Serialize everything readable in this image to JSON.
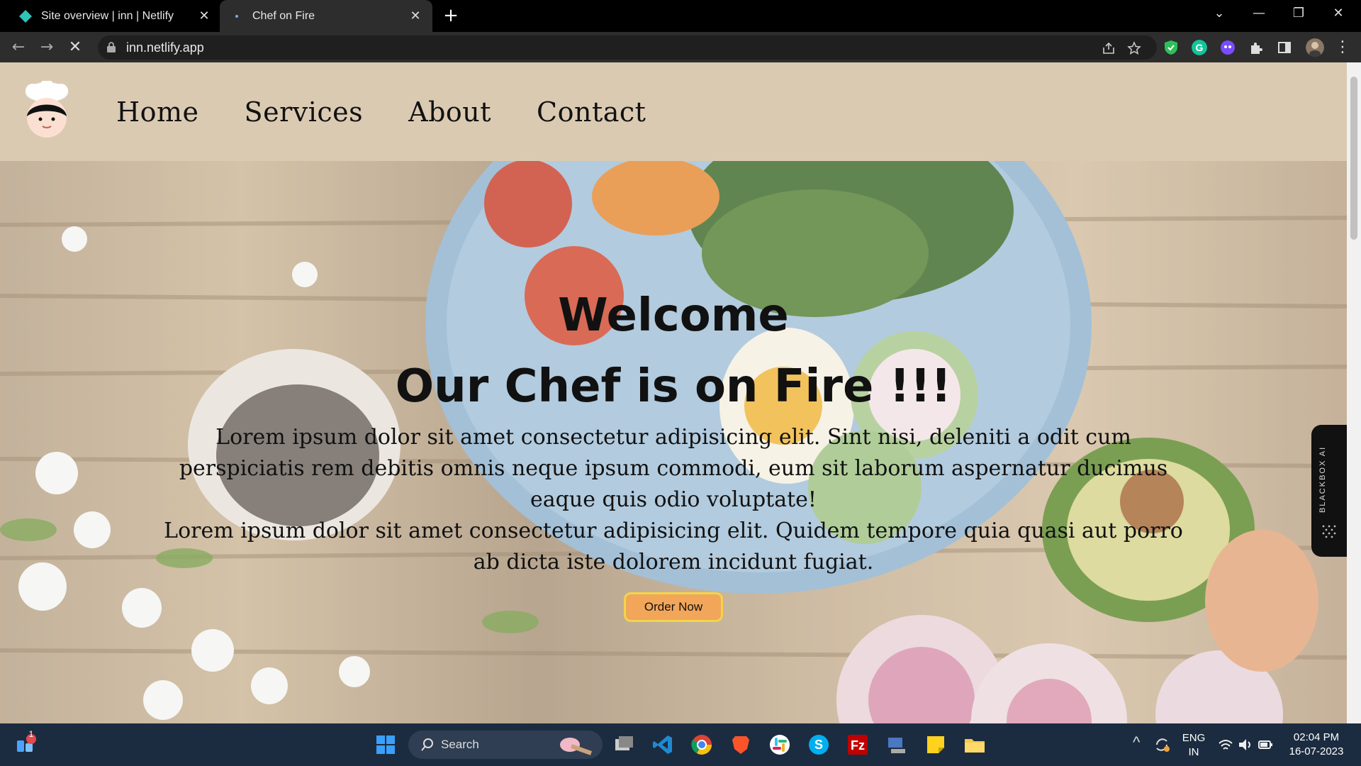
{
  "browser": {
    "tabs": [
      {
        "title": "Site overview | inn | Netlify",
        "active": false,
        "close": "✕"
      },
      {
        "title": "Chef on Fire",
        "active": true,
        "close": "✕"
      }
    ],
    "new_tab": "+",
    "url": "inn.netlify.app",
    "window_controls": {
      "minimize": "—",
      "restore": "❐",
      "close": "✕"
    }
  },
  "site": {
    "nav": [
      "Home",
      "Services",
      "About",
      "Contact"
    ],
    "hero": {
      "title_line1": "Welcome",
      "title_line2": "Our Chef is on Fire !!!",
      "paragraph1": "Lorem ipsum dolor sit amet consectetur adipisicing elit. Sint nisi, deleniti a odit cum perspiciatis rem debitis omnis neque ipsum commodi, eum sit laborum aspernatur ducimus eaque quis odio voluptate!",
      "paragraph2": "Lorem ipsum dolor sit amet consectetur adipisicing elit. Quidem tempore quia quasi aut porro ab dicta iste dolorem incidunt fugiat.",
      "button": "Order Now"
    },
    "side_widget": "BLACKBOX AI"
  },
  "taskbar": {
    "search_label": "Search",
    "notification_count": "1",
    "language": "ENG",
    "region": "IN",
    "time": "02:04 PM",
    "date": "16-07-2023"
  }
}
